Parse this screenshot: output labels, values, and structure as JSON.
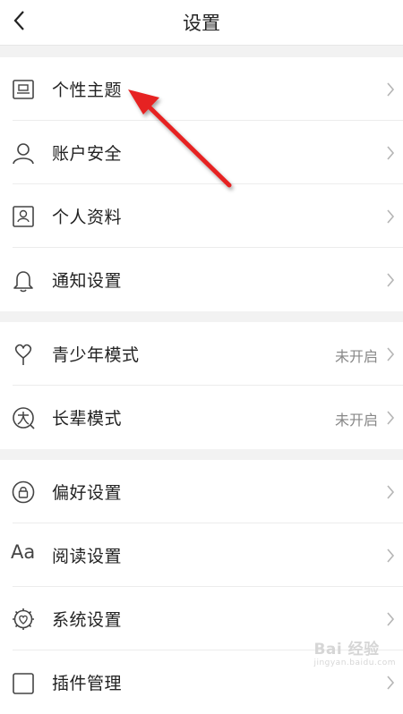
{
  "nav": {
    "title": "设置"
  },
  "group1": [
    {
      "label": "个性主题",
      "icon": "theme-icon"
    },
    {
      "label": "账户安全",
      "icon": "user-icon"
    },
    {
      "label": "个人资料",
      "icon": "profile-card-icon"
    },
    {
      "label": "通知设置",
      "icon": "bell-icon"
    }
  ],
  "group2": [
    {
      "label": "青少年模式",
      "status": "未开启",
      "icon": "youth-icon"
    },
    {
      "label": "长辈模式",
      "status": "未开启",
      "icon": "elder-icon"
    }
  ],
  "group3": [
    {
      "label": "偏好设置",
      "icon": "lock-circle-icon"
    },
    {
      "label": "阅读设置",
      "icon_text": "Aa",
      "icon": "font-size-icon"
    },
    {
      "label": "系统设置",
      "icon": "gear-icon"
    },
    {
      "label": "插件管理",
      "icon": "plugin-icon"
    }
  ],
  "watermark": {
    "text": "Bai 经验",
    "sub": "jingyan.baidu.com"
  },
  "colors": {
    "arrow": "#e62420",
    "chevron": "#b5b5b5",
    "icon": "#444444"
  }
}
